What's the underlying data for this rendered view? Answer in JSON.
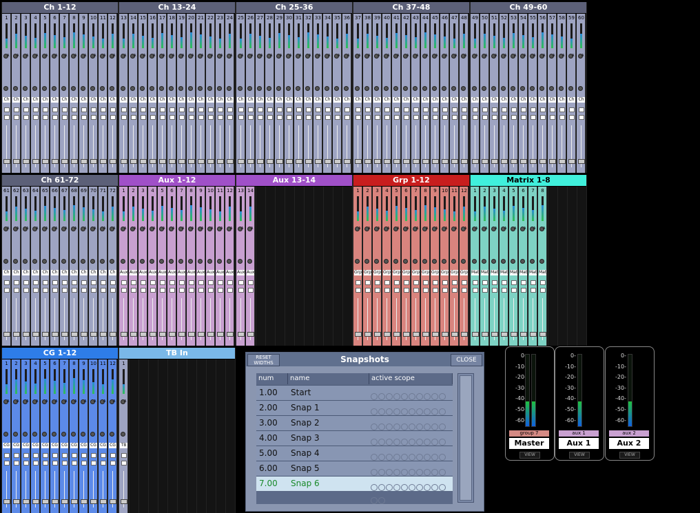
{
  "banks": [
    {
      "title": "Ch 1-12",
      "nums": [
        "1",
        "2",
        "3",
        "4",
        "5",
        "6",
        "7",
        "8",
        "9",
        "10",
        "11",
        "12"
      ],
      "short": "Ch",
      "color": "#9ea4c2",
      "title_bg": "#5c6078"
    },
    {
      "title": "Ch 13-24",
      "nums": [
        "13",
        "14",
        "15",
        "16",
        "17",
        "18",
        "19",
        "20",
        "21",
        "22",
        "23",
        "24"
      ],
      "short": "Ch",
      "color": "#9ea4c2",
      "title_bg": "#5c6078"
    },
    {
      "title": "Ch 25-36",
      "nums": [
        "25",
        "26",
        "27",
        "28",
        "29",
        "30",
        "31",
        "32",
        "33",
        "34",
        "35",
        "36"
      ],
      "short": "Ch",
      "color": "#9ea4c2",
      "title_bg": "#5c6078"
    },
    {
      "title": "Ch 37-48",
      "nums": [
        "37",
        "38",
        "39",
        "40",
        "41",
        "42",
        "43",
        "44",
        "45",
        "46",
        "47",
        "48"
      ],
      "short": "Ch",
      "color": "#9ea4c2",
      "title_bg": "#5c6078"
    },
    {
      "title": "Ch 49-60",
      "nums": [
        "49",
        "50",
        "51",
        "52",
        "53",
        "54",
        "55",
        "56",
        "57",
        "58",
        "59",
        "60"
      ],
      "short": "Ch",
      "color": "#9ea4c2",
      "title_bg": "#5c6078"
    },
    {
      "title": "Ch 61-72",
      "nums": [
        "61",
        "62",
        "63",
        "64",
        "65",
        "66",
        "67",
        "68",
        "69",
        "70",
        "71",
        "72"
      ],
      "short": "Ch",
      "color": "#9ea4c2",
      "title_bg": "#5c6078"
    },
    {
      "title": "Aux 1-12",
      "nums": [
        "1",
        "2",
        "3",
        "4",
        "5",
        "6",
        "7",
        "8",
        "9",
        "10",
        "11",
        "12"
      ],
      "short": "Aux",
      "color": "#c8a0d0",
      "title_bg": "#a050c8"
    },
    {
      "title": "Aux 13-14",
      "nums": [
        "13",
        "14"
      ],
      "short": "Aux",
      "color": "#c8a0d0",
      "title_bg": "#a050c8"
    },
    {
      "title": "Grp 1-12",
      "nums": [
        "1",
        "2",
        "3",
        "4",
        "5",
        "6",
        "7",
        "8",
        "9",
        "10",
        "11",
        "12"
      ],
      "short": "Grp",
      "color": "#d9847e",
      "title_bg": "#c81e1e"
    },
    {
      "title": "Matrix 1-8",
      "nums": [
        "1",
        "2",
        "3",
        "4",
        "5",
        "6",
        "7",
        "8"
      ],
      "short": "Mat",
      "color": "#7ed2c4",
      "title_bg": "#40f0dc"
    },
    {
      "title": "CG 1-12",
      "nums": [
        "1",
        "2",
        "3",
        "4",
        "5",
        "6",
        "7",
        "8",
        "9",
        "10",
        "11",
        "12"
      ],
      "short": "CG",
      "color": "#5c8ae8",
      "title_bg": "#2e7de8"
    },
    {
      "title": "TB In",
      "nums": [
        "1"
      ],
      "short": "TB",
      "color": "#9ea4c2",
      "title_bg": "#7ab8e8"
    }
  ],
  "snapshots": {
    "reset_label_1": "RESET",
    "reset_label_2": "WIDTHS",
    "title": "Snapshots",
    "close_label": "CLOSE",
    "columns": [
      "num",
      "name",
      "active scope"
    ],
    "rows": [
      {
        "num": "1.00",
        "name": "Start"
      },
      {
        "num": "2.00",
        "name": "Snap 1"
      },
      {
        "num": "3.00",
        "name": "Snap 2"
      },
      {
        "num": "4.00",
        "name": "Snap 3"
      },
      {
        "num": "5.00",
        "name": "Snap 4"
      },
      {
        "num": "6.00",
        "name": "Snap 5"
      },
      {
        "num": "7.00",
        "name": "Snap 6"
      }
    ],
    "selected_index": 6
  },
  "meters": [
    {
      "label": "Master",
      "tag": "group 7",
      "tag_color": "#d48a84",
      "scale": [
        "0-",
        "-10-",
        "-20-",
        "-30-",
        "-40-",
        "-50-",
        "-60-"
      ],
      "bars": 2
    },
    {
      "label": "Aux 1",
      "tag": "aux 1",
      "tag_color": "#c8a0d0",
      "scale": [
        "0-",
        "-10-",
        "-20-",
        "-30-",
        "-40-",
        "-50-",
        "-60-"
      ],
      "bars": 1
    },
    {
      "label": "Aux 2",
      "tag": "aux 2",
      "tag_color": "#c8a0d0",
      "scale": [
        "0-",
        "-10-",
        "-20-",
        "-30-",
        "-40-",
        "-50-",
        "-60-"
      ],
      "bars": 1
    }
  ],
  "meter_view_label": "VIEW"
}
